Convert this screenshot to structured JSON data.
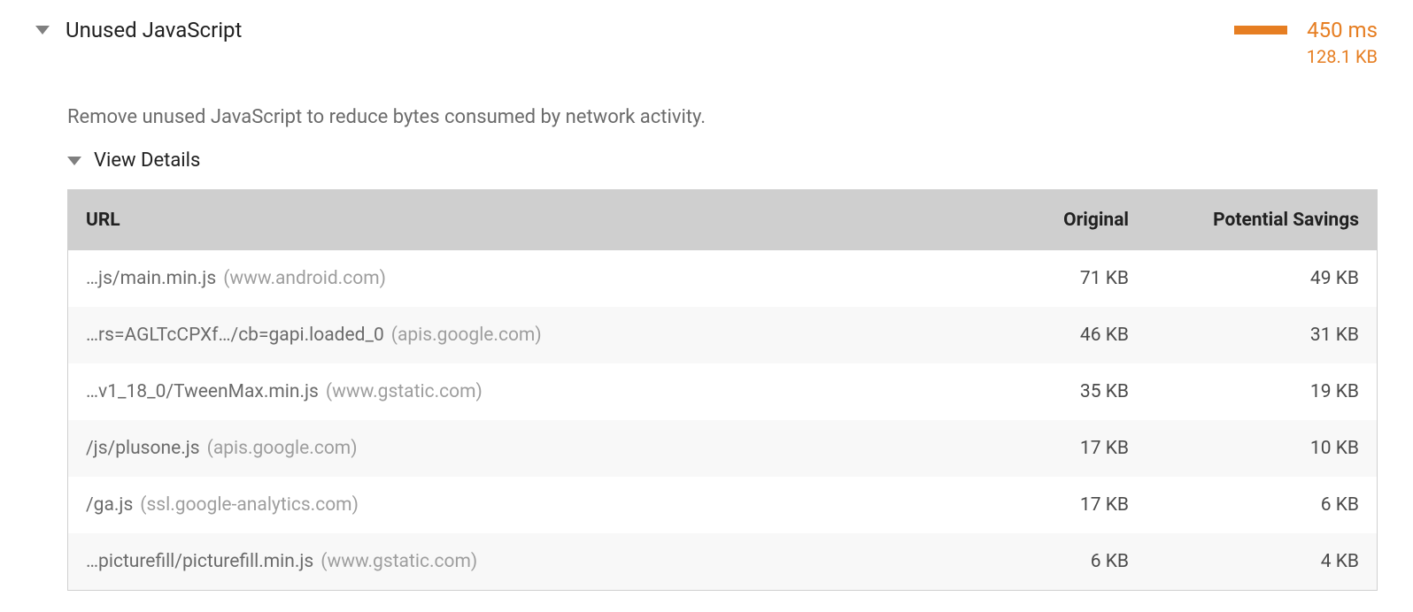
{
  "audit": {
    "title": "Unused JavaScript",
    "description": "Remove unused JavaScript to reduce bytes consumed by network activity.",
    "savings_time": "450 ms",
    "savings_size": "128.1 KB",
    "details_label": "View Details"
  },
  "table": {
    "headers": {
      "url": "URL",
      "original": "Original",
      "savings": "Potential Savings"
    },
    "rows": [
      {
        "path": "…js/main.min.js",
        "domain": "(www.android.com)",
        "original": "71 KB",
        "savings": "49 KB"
      },
      {
        "path": "…rs=AGLTcCPXf…/cb=gapi.loaded_0",
        "domain": "(apis.google.com)",
        "original": "46 KB",
        "savings": "31 KB"
      },
      {
        "path": "…v1_18_0/TweenMax.min.js",
        "domain": "(www.gstatic.com)",
        "original": "35 KB",
        "savings": "19 KB"
      },
      {
        "path": "/js/plusone.js",
        "domain": "(apis.google.com)",
        "original": "17 KB",
        "savings": "10 KB"
      },
      {
        "path": "/ga.js",
        "domain": "(ssl.google-analytics.com)",
        "original": "17 KB",
        "savings": "6 KB"
      },
      {
        "path": "…picturefill/picturefill.min.js",
        "domain": "(www.gstatic.com)",
        "original": "6 KB",
        "savings": "4 KB"
      }
    ]
  }
}
